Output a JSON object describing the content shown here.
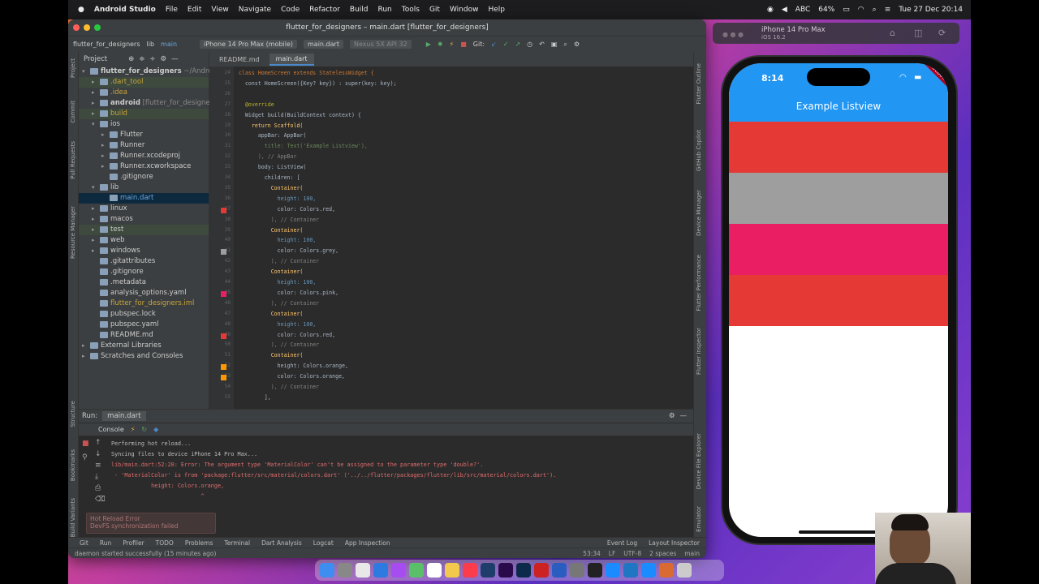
{
  "menubar": {
    "app": "Android Studio",
    "items": [
      "File",
      "Edit",
      "View",
      "Navigate",
      "Code",
      "Refactor",
      "Build",
      "Run",
      "Tools",
      "Git",
      "Window",
      "Help"
    ],
    "battery": "64%",
    "input": "ABC",
    "datetime": "Tue 27 Dec 20:14"
  },
  "ide": {
    "title": "flutter_for_designers – main.dart [flutter_for_designers]",
    "nav": {
      "project": "flutter_for_designers",
      "lib": "lib",
      "file": "main",
      "device": "iPhone 14 Pro Max (mobile)",
      "config": "main.dart",
      "emulator": "Nexus 5X API 32",
      "git": "Git:"
    },
    "project_panel": {
      "header": "Project",
      "items": [
        {
          "label": "flutter_for_designers",
          "suffix": "~/Android",
          "indent": 0,
          "arrow": "▾",
          "color": "#ccc",
          "bold": true
        },
        {
          "label": ".dart_tool",
          "indent": 1,
          "arrow": "▸",
          "color": "#c9a43a",
          "hl": true
        },
        {
          "label": ".idea",
          "indent": 1,
          "arrow": "▸",
          "color": "#c9a43a"
        },
        {
          "label": "android",
          "suffix": "[flutter_for_designe",
          "indent": 1,
          "arrow": "▸",
          "color": "#ccc",
          "bold": true
        },
        {
          "label": "build",
          "indent": 1,
          "arrow": "▸",
          "color": "#c9a43a",
          "hl": true
        },
        {
          "label": "ios",
          "indent": 1,
          "arrow": "▾",
          "color": "#ccc"
        },
        {
          "label": "Flutter",
          "indent": 2,
          "arrow": "▸",
          "color": "#ccc"
        },
        {
          "label": "Runner",
          "indent": 2,
          "arrow": "▸",
          "color": "#ccc"
        },
        {
          "label": "Runner.xcodeproj",
          "indent": 2,
          "arrow": "▸",
          "color": "#ccc"
        },
        {
          "label": "Runner.xcworkspace",
          "indent": 2,
          "arrow": "▸",
          "color": "#ccc"
        },
        {
          "label": ".gitignore",
          "indent": 2,
          "arrow": "",
          "color": "#ccc"
        },
        {
          "label": "lib",
          "indent": 1,
          "arrow": "▾",
          "color": "#ccc"
        },
        {
          "label": "main.dart",
          "indent": 2,
          "arrow": "",
          "color": "#6aa8e0",
          "sel": true
        },
        {
          "label": "linux",
          "indent": 1,
          "arrow": "▸",
          "color": "#ccc"
        },
        {
          "label": "macos",
          "indent": 1,
          "arrow": "▸",
          "color": "#ccc"
        },
        {
          "label": "test",
          "indent": 1,
          "arrow": "▸",
          "color": "#ccc",
          "hl": true
        },
        {
          "label": "web",
          "indent": 1,
          "arrow": "▸",
          "color": "#ccc"
        },
        {
          "label": "windows",
          "indent": 1,
          "arrow": "▸",
          "color": "#ccc"
        },
        {
          "label": ".gitattributes",
          "indent": 1,
          "arrow": "",
          "color": "#ccc"
        },
        {
          "label": ".gitignore",
          "indent": 1,
          "arrow": "",
          "color": "#ccc"
        },
        {
          "label": ".metadata",
          "indent": 1,
          "arrow": "",
          "color": "#ccc"
        },
        {
          "label": "analysis_options.yaml",
          "indent": 1,
          "arrow": "",
          "color": "#ccc"
        },
        {
          "label": "flutter_for_designers.iml",
          "indent": 1,
          "arrow": "",
          "color": "#c9a43a"
        },
        {
          "label": "pubspec.lock",
          "indent": 1,
          "arrow": "",
          "color": "#ccc"
        },
        {
          "label": "pubspec.yaml",
          "indent": 1,
          "arrow": "",
          "color": "#ccc"
        },
        {
          "label": "README.md",
          "indent": 1,
          "arrow": "",
          "color": "#ccc"
        },
        {
          "label": "External Libraries",
          "indent": 0,
          "arrow": "▸",
          "color": "#ccc"
        },
        {
          "label": "Scratches and Consoles",
          "indent": 0,
          "arrow": "▸",
          "color": "#ccc"
        }
      ]
    },
    "tabs": [
      "README.md",
      "main.dart"
    ],
    "code": [
      {
        "n": "24",
        "t": "class HomeScreen extends StatelessWidget {",
        "c": "#cc7832",
        "i": 0
      },
      {
        "n": "25",
        "t": "  const HomeScreen({Key? key}) : super(key: key);",
        "c": "#a9b7c6",
        "i": 0
      },
      {
        "n": "26",
        "t": "",
        "c": "#a9b7c6",
        "i": 0
      },
      {
        "n": "27",
        "t": "  @override",
        "c": "#bbb529",
        "i": 0
      },
      {
        "n": "28",
        "t": "  Widget build(BuildContext context) {",
        "c": "#a9b7c6",
        "i": 0
      },
      {
        "n": "29",
        "t": "    return Scaffold(",
        "c": "#ffc66d",
        "i": 0
      },
      {
        "n": "30",
        "t": "      appBar: AppBar(",
        "c": "#a9b7c6",
        "i": 0
      },
      {
        "n": "31",
        "t": "        title: Text('Example Listview'),",
        "c": "#6a8759",
        "i": 0
      },
      {
        "n": "32",
        "t": "      ), // AppBar",
        "c": "#808080",
        "i": 0
      },
      {
        "n": "33",
        "t": "      body: ListView(",
        "c": "#a9b7c6",
        "i": 0
      },
      {
        "n": "34",
        "t": "        children: [",
        "c": "#a9b7c6",
        "i": 0
      },
      {
        "n": "35",
        "t": "          Container(",
        "c": "#ffc66d",
        "i": 0
      },
      {
        "n": "36",
        "t": "            height: 100,",
        "c": "#6897bb",
        "i": 0
      },
      {
        "n": "37",
        "t": "            color: Colors.red,",
        "c": "#a9b7c6",
        "i": 0,
        "sw": "#e53935"
      },
      {
        "n": "38",
        "t": "          ), // Container",
        "c": "#808080",
        "i": 0
      },
      {
        "n": "39",
        "t": "          Container(",
        "c": "#ffc66d",
        "i": 0
      },
      {
        "n": "40",
        "t": "            height: 100,",
        "c": "#6897bb",
        "i": 0
      },
      {
        "n": "41",
        "t": "            color: Colors.grey,",
        "c": "#a9b7c6",
        "i": 0,
        "sw": "#9e9e9e"
      },
      {
        "n": "42",
        "t": "          ), // Container",
        "c": "#808080",
        "i": 0
      },
      {
        "n": "43",
        "t": "          Container(",
        "c": "#ffc66d",
        "i": 0
      },
      {
        "n": "44",
        "t": "            height: 100,",
        "c": "#6897bb",
        "i": 0
      },
      {
        "n": "45",
        "t": "            color: Colors.pink,",
        "c": "#a9b7c6",
        "i": 0,
        "sw": "#e91e63"
      },
      {
        "n": "46",
        "t": "          ), // Container",
        "c": "#808080",
        "i": 0
      },
      {
        "n": "47",
        "t": "          Container(",
        "c": "#ffc66d",
        "i": 0
      },
      {
        "n": "48",
        "t": "            height: 100,",
        "c": "#6897bb",
        "i": 0
      },
      {
        "n": "49",
        "t": "            color: Colors.red,",
        "c": "#a9b7c6",
        "i": 0,
        "sw": "#e53935"
      },
      {
        "n": "50",
        "t": "          ), // Container",
        "c": "#808080",
        "i": 0
      },
      {
        "n": "51",
        "t": "          Container(",
        "c": "#ffc66d",
        "i": 0
      },
      {
        "n": "52",
        "t": "            height: Colors.orange,",
        "c": "#a9b7c6",
        "i": 0,
        "sw": "#ff9800"
      },
      {
        "n": "53",
        "t": "            color: Colors.orange,",
        "c": "#a9b7c6",
        "i": 0,
        "sw": "#ff9800"
      },
      {
        "n": "54",
        "t": "          ), // Container",
        "c": "#808080",
        "i": 0
      },
      {
        "n": "55",
        "t": "        ],",
        "c": "#a9b7c6",
        "i": 0
      }
    ],
    "run": {
      "label": "Run:",
      "config": "main.dart",
      "console": "Console",
      "lines": [
        {
          "t": "Performing hot reload...",
          "c": "#bbb"
        },
        {
          "t": "Syncing files to device iPhone 14 Pro Max...",
          "c": "#bbb"
        },
        {
          "t": "lib/main.dart:52:28: Error: The argument type 'MaterialColor' can't be assigned to the parameter type 'double?'.",
          "c": "#e06c6c"
        },
        {
          "t": " - 'MaterialColor' is from 'package:flutter/src/material/colors.dart' ('../../flutter/packages/flutter/lib/src/material/colors.dart').",
          "c": "#e06c6c"
        },
        {
          "t": "            height: Colors.orange,",
          "c": "#e06c6c"
        },
        {
          "t": "                           ^",
          "c": "#e06c6c"
        }
      ]
    },
    "toast": {
      "title": "Hot Reload Error",
      "body": "DevFS synchronization failed"
    },
    "bottom_tabs": [
      "Git",
      "Run",
      "Profiler",
      "TODO",
      "Problems",
      "Terminal",
      "Dart Analysis",
      "Logcat",
      "App Inspection",
      "Event Log",
      "Layout Inspector"
    ],
    "status": {
      "left": "daemon started successfully (15 minutes ago)",
      "pos": "53:34",
      "le": "LF",
      "enc": "UTF-8",
      "indent": "2 spaces",
      "branch": "main"
    }
  },
  "simulator": {
    "device": "iPhone 14 Pro Max",
    "os": "iOS 16.2",
    "time": "8:14",
    "appbar_title": "Example Listview",
    "appbar_color": "#2196f3",
    "debug": "DEBUG",
    "containers": [
      {
        "color": "#e53935",
        "name": "red"
      },
      {
        "color": "#9e9e9e",
        "name": "grey"
      },
      {
        "color": "#e91e63",
        "name": "pink"
      },
      {
        "color": "#e53935",
        "name": "red"
      }
    ]
  },
  "dock": {
    "apps": [
      "finder",
      "launchpad",
      "chrome",
      "safari",
      "messenger",
      "maps",
      "calendar",
      "notes",
      "music",
      "lightroom",
      "premiere",
      "photoshop",
      "acrobat",
      "word",
      "settings",
      "figma",
      "xcode",
      "vscode",
      "appstore",
      "finder2",
      "trash"
    ]
  }
}
